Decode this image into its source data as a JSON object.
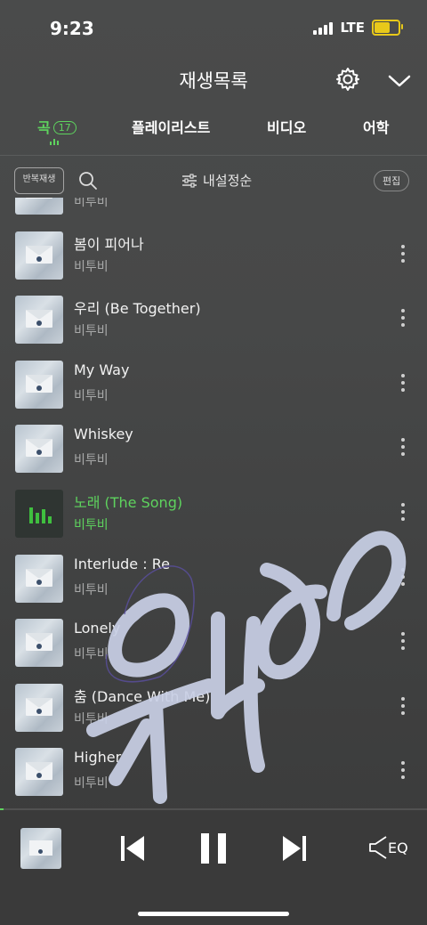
{
  "status_bar": {
    "time": "9:23",
    "network": "LTE"
  },
  "header": {
    "title": "재생목록"
  },
  "tabs": [
    {
      "label": "곡",
      "badge": "17",
      "active": true
    },
    {
      "label": "플레이리스트"
    },
    {
      "label": "비디오"
    },
    {
      "label": "어학"
    }
  ],
  "controls": {
    "repeat_label": "반복재생",
    "sort_label": "내설정순",
    "edit_label": "편집"
  },
  "songs": [
    {
      "title": "노래 (The Song)",
      "artist": "비투비"
    },
    {
      "title": "봄이 피어나",
      "artist": "비투비"
    },
    {
      "title": "우리 (Be Together)",
      "artist": "비투비"
    },
    {
      "title": "My Way",
      "artist": "비투비"
    },
    {
      "title": "Whiskey",
      "artist": "비투비"
    },
    {
      "title": "노래 (The Song)",
      "artist": "비투비",
      "playing": true
    },
    {
      "title": "Interlude : Re",
      "artist": "비투비"
    },
    {
      "title": "Lonely",
      "artist": "비투비"
    },
    {
      "title": "춤 (Dance With Me)",
      "artist": "비투비"
    },
    {
      "title": "Higher",
      "artist": "비투비"
    }
  ],
  "player": {
    "eq_label": "EQ"
  },
  "colors": {
    "accent": "#5ed35e",
    "background": "#474848",
    "overlay_stroke": "#c9d0e6"
  }
}
